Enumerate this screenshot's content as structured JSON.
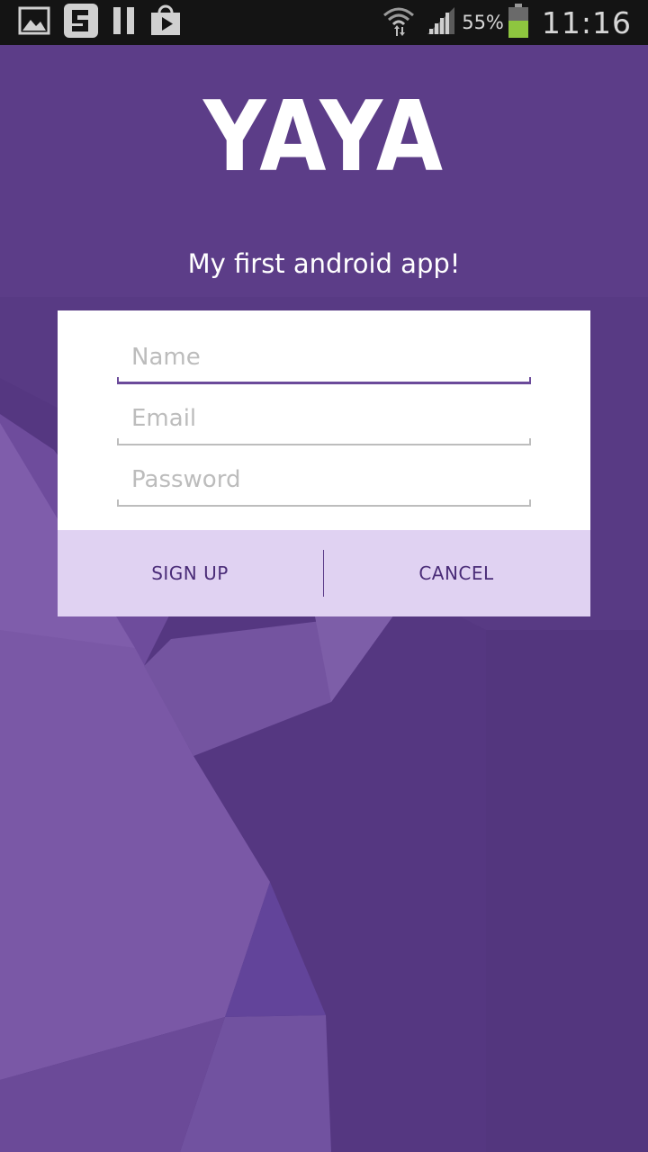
{
  "status_bar": {
    "left_icons": [
      "gallery-icon",
      "app-notification-icon",
      "pause-icon",
      "play-store-icon"
    ],
    "right_icons": [
      "wifi-icon",
      "signal-icon",
      "battery-icon"
    ],
    "battery_percent": "55%",
    "battery_level": 0.55,
    "time": "11:16"
  },
  "app": {
    "logo": "YAYA",
    "tagline": "My first android app!"
  },
  "form": {
    "name_placeholder": "Name",
    "email_placeholder": "Email",
    "password_placeholder": "Password",
    "name_value": "",
    "email_value": "",
    "password_value": ""
  },
  "buttons": {
    "sign_up": "SIGN UP",
    "cancel": "CANCEL"
  },
  "colors": {
    "background": "#553781",
    "status_bar": "#141414",
    "card": "#ffffff",
    "button_bar": "#e0d2f2",
    "button_text": "#4a2c78",
    "active_underline": "#6b4a9a",
    "battery_fill": "#8ec63f"
  }
}
